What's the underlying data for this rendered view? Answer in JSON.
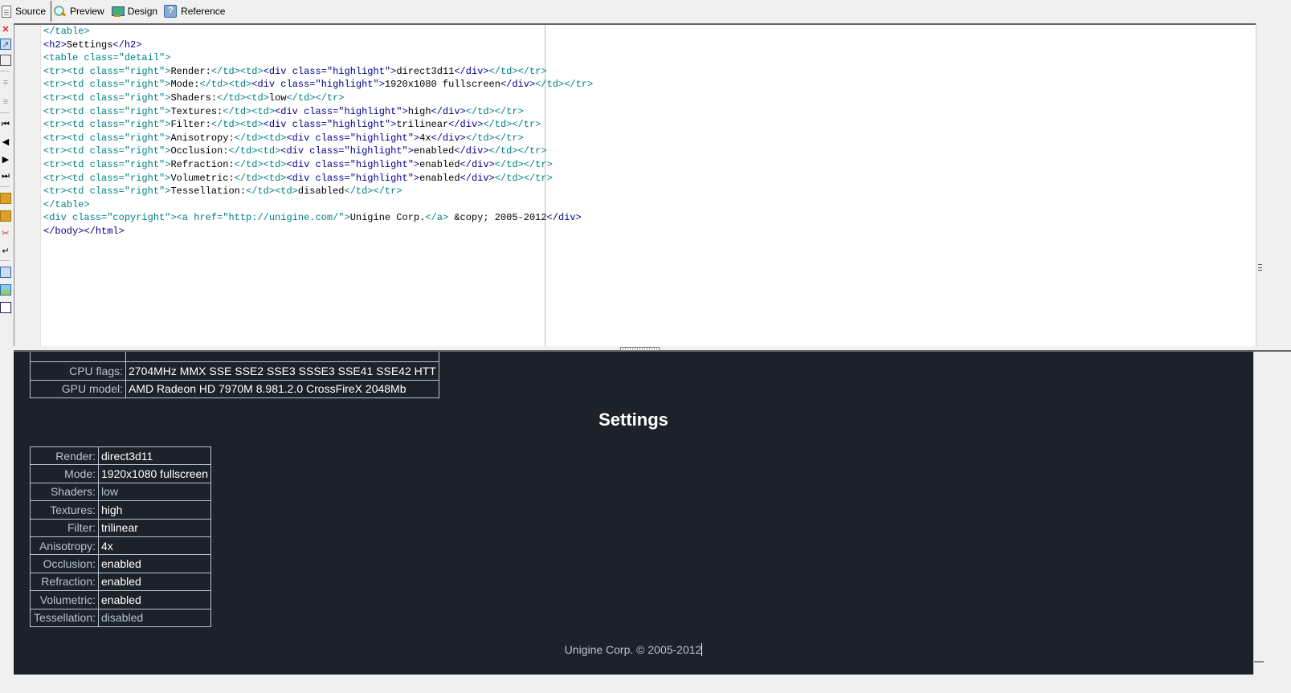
{
  "tabs": [
    {
      "label": "Source",
      "icon": "source-page-icon",
      "active": true
    },
    {
      "label": "Preview",
      "icon": "magnifier-icon",
      "active": false
    },
    {
      "label": "Design",
      "icon": "monitor-icon",
      "active": false
    },
    {
      "label": "Reference",
      "icon": "help-book-icon",
      "active": false
    }
  ],
  "left_toolbar": [
    "close-icon",
    "open-external-icon",
    "windows-icon",
    "indent-icon",
    "outdent-icon",
    "first-icon",
    "previous-icon",
    "next-icon",
    "last-icon",
    "add-folder-icon",
    "export-folder-icon",
    "tools-icon",
    "word-wrap-icon",
    "compare-icon",
    "layout-icon",
    "dotted-box-icon"
  ],
  "code_lines": [
    "</table>",
    "<h2>Settings</h2>",
    "<table class=\"detail\">",
    "<tr><td class=\"right\">Render:</td><td><div class=\"highlight\">direct3d11</div></td></tr>",
    "<tr><td class=\"right\">Mode:</td><td><div class=\"highlight\">1920x1080 fullscreen</div></td></tr>",
    "<tr><td class=\"right\">Shaders:</td><td>low</td></tr>",
    "<tr><td class=\"right\">Textures:</td><td><div class=\"highlight\">high</div></td></tr>",
    "<tr><td class=\"right\">Filter:</td><td><div class=\"highlight\">trilinear</div></td></tr>",
    "<tr><td class=\"right\">Anisotropy:</td><td><div class=\"highlight\">4x</div></td></tr>",
    "<tr><td class=\"right\">Occlusion:</td><td><div class=\"highlight\">enabled</div></td></tr>",
    "<tr><td class=\"right\">Refraction:</td><td><div class=\"highlight\">enabled</div></td></tr>",
    "<tr><td class=\"right\">Volumetric:</td><td><div class=\"highlight\">enabled</div></td></tr>",
    "<tr><td class=\"right\">Tessellation:</td><td>disabled</td></tr>",
    "</table>",
    "<div class=\"copyright\"><a href=\"http://unigine.com/\">Unigine Corp.</a> &copy; 2005-2012</div>",
    "</body></html>"
  ],
  "preview": {
    "info_rows": [
      {
        "label": "CPU flags:",
        "value": "2704MHz MMX SSE SSE2 SSE3 SSSE3 SSE41 SSE42 HTT"
      },
      {
        "label": "GPU model:",
        "value": "AMD Radeon HD 7970M 8.981.2.0 CrossFireX 2048Mb"
      }
    ],
    "heading": "Settings",
    "settings": [
      {
        "label": "Render:",
        "value": "direct3d11",
        "highlight": true
      },
      {
        "label": "Mode:",
        "value": "1920x1080 fullscreen",
        "highlight": true
      },
      {
        "label": "Shaders:",
        "value": "low",
        "highlight": false
      },
      {
        "label": "Textures:",
        "value": "high",
        "highlight": true
      },
      {
        "label": "Filter:",
        "value": "trilinear",
        "highlight": true
      },
      {
        "label": "Anisotropy:",
        "value": "4x",
        "highlight": true
      },
      {
        "label": "Occlusion:",
        "value": "enabled",
        "highlight": true
      },
      {
        "label": "Refraction:",
        "value": "enabled",
        "highlight": true
      },
      {
        "label": "Volumetric:",
        "value": "enabled",
        "highlight": true
      },
      {
        "label": "Tessellation:",
        "value": "disabled",
        "highlight": false
      }
    ],
    "copyright_link": "Unigine Corp.",
    "copyright_text": " © 2005-2012"
  },
  "colors": {
    "preview_bg": "#1d222a",
    "label_color": "#b4c4d0",
    "highlight_color": "#ffffff",
    "tag_color": "#008080",
    "tagname_color": "#00008b"
  }
}
